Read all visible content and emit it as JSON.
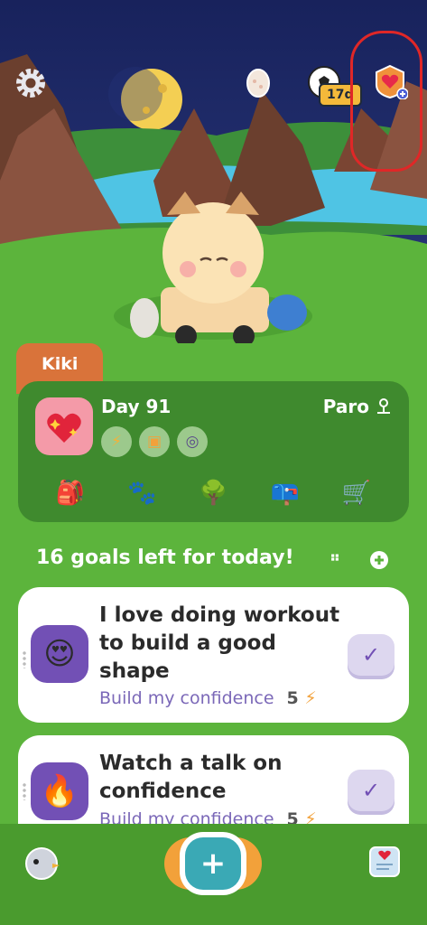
{
  "top": {
    "streak_days": "17d"
  },
  "character": {
    "name": "Kiki"
  },
  "status": {
    "day_label": "Day 91",
    "pet_name": "Paro",
    "badges": [
      "lightning-badge",
      "card-badge",
      "beads-badge"
    ]
  },
  "menu_icons": [
    "backpack-icon",
    "paw-icon",
    "tree-icon",
    "mailbox-icon",
    "cart-icon"
  ],
  "goals": {
    "header": "16 goals left for today!",
    "items": [
      {
        "title": "I love doing workout to build a good shape",
        "category": "Build my confidence",
        "points": "5"
      },
      {
        "title": "Watch a talk on confidence",
        "category": "Build my confidence",
        "points": "5"
      }
    ]
  },
  "colors": {
    "grass": "#5cb43c",
    "card": "#3f8a2e",
    "accent_purple": "#7250b5",
    "tab_orange": "#d9733a"
  }
}
